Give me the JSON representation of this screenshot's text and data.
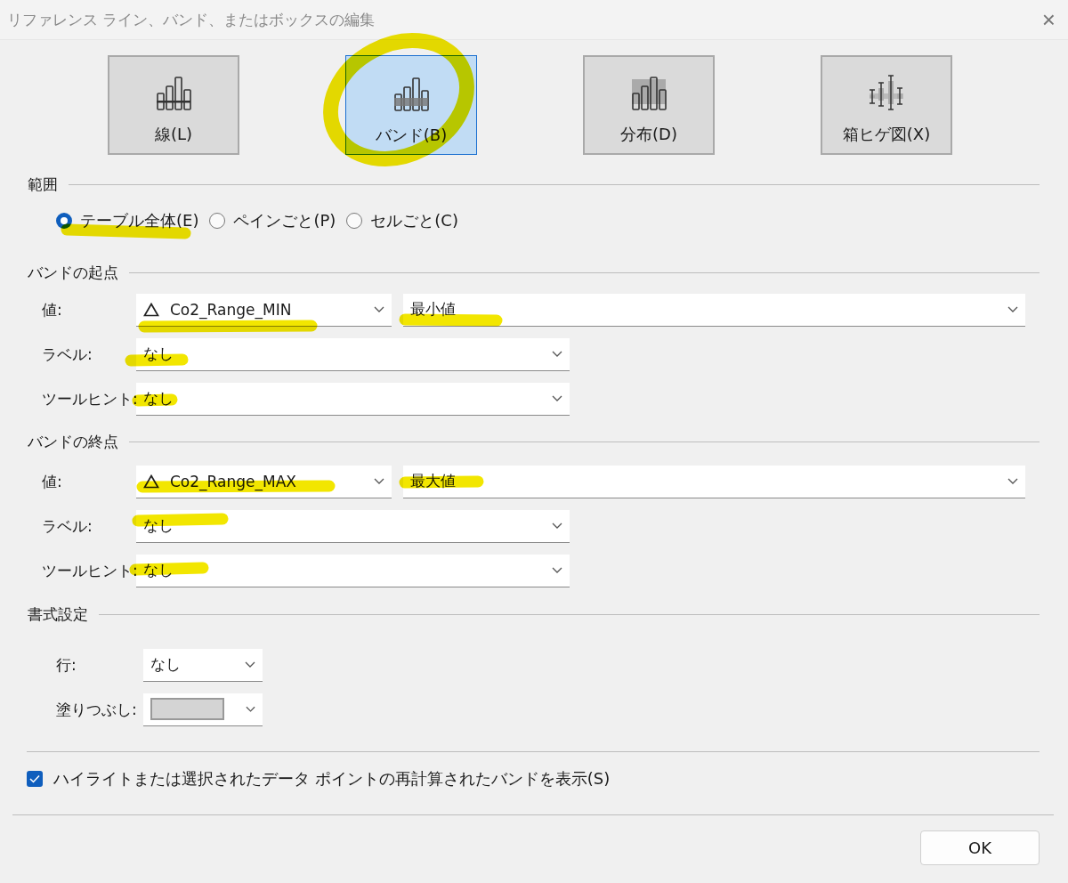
{
  "window": {
    "title": "リファレンス ライン、バンド、またはボックスの編集",
    "close": "×"
  },
  "types": [
    {
      "kind": "line",
      "label": "線(L)",
      "selected": false
    },
    {
      "kind": "band",
      "label": "バンド(B)",
      "selected": true
    },
    {
      "kind": "distribution",
      "label": "分布(D)",
      "selected": false
    },
    {
      "kind": "boxplot",
      "label": "箱ヒゲ図(X)",
      "selected": false
    }
  ],
  "scope": {
    "title": "範囲",
    "options": [
      {
        "label": "テーブル全体(E)",
        "selected": true
      },
      {
        "label": "ペインごと(P)",
        "selected": false
      },
      {
        "label": "セルごと(C)",
        "selected": false
      }
    ]
  },
  "band_from": {
    "title": "バンドの起点",
    "value": {
      "label": "値:",
      "field": "Co2_Range_MIN",
      "aggregation": "最小値"
    },
    "rows": [
      {
        "label": "ラベル:",
        "value": "なし"
      },
      {
        "label": "ツールヒント:",
        "value": "なし"
      }
    ]
  },
  "band_to": {
    "title": "バンドの終点",
    "value": {
      "label": "値:",
      "field": "Co2_Range_MAX",
      "aggregation": "最大値"
    },
    "rows": [
      {
        "label": "ラベル:",
        "value": "なし"
      },
      {
        "label": "ツールヒント:",
        "value": "なし"
      }
    ]
  },
  "formatting": {
    "title": "書式設定",
    "line": {
      "label": "行:",
      "value": "なし"
    },
    "fill": {
      "label": "塗りつぶし:",
      "color": "#d4d4d4"
    }
  },
  "recalculate": {
    "label": "ハイライトまたは選択されたデータ ポイントの再計算されたバンドを表示(S)",
    "checked": true
  },
  "buttons": [
    "OK"
  ]
}
